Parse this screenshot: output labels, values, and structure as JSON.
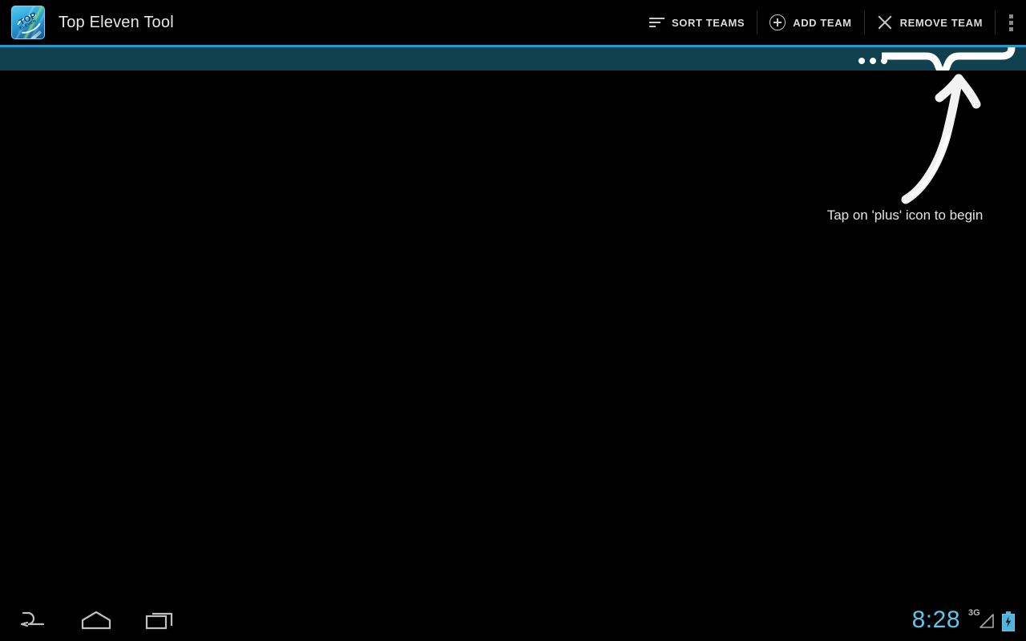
{
  "app": {
    "title": "Top Eleven Tool",
    "icon_name": "top-eleven-app-icon",
    "icon_text_top": "TOP",
    "icon_text_bottom": "ELEVEN"
  },
  "action_bar": {
    "actions": [
      {
        "id": "sort-teams",
        "label": "SORT TEAMS",
        "icon": "sort-icon"
      },
      {
        "id": "add-team",
        "label": "ADD TEAM",
        "icon": "plus-circle-icon"
      },
      {
        "id": "remove-team",
        "label": "REMOVE TEAM",
        "icon": "close-x-icon"
      }
    ],
    "overflow": {
      "id": "overflow-menu",
      "icon": "overflow-dots-icon",
      "label": "More options"
    }
  },
  "tutorial": {
    "hint_text": "Tap on 'plus' icon to begin",
    "dots_count": 3,
    "arrow_icon": "chalk-arrow-icon",
    "brace_icon": "callout-brace-icon"
  },
  "system_bar": {
    "nav": [
      {
        "id": "back",
        "icon": "back-arrow-icon",
        "label": "Back"
      },
      {
        "id": "home",
        "icon": "home-icon",
        "label": "Home"
      },
      {
        "id": "recents",
        "icon": "recent-apps-icon",
        "label": "Recent apps"
      }
    ],
    "clock": "8:28",
    "network_type": "3G",
    "signal_icon": "signal-triangle-icon",
    "battery_icon": "battery-charging-icon"
  },
  "colors": {
    "background": "#000000",
    "teal_bar": "#11414f",
    "teal_bar_top_stripe": "#2b94c9",
    "accent_blue": "#5cc6ef",
    "action_text": "#dcdcdc",
    "hint_text": "#e3e3e3"
  }
}
